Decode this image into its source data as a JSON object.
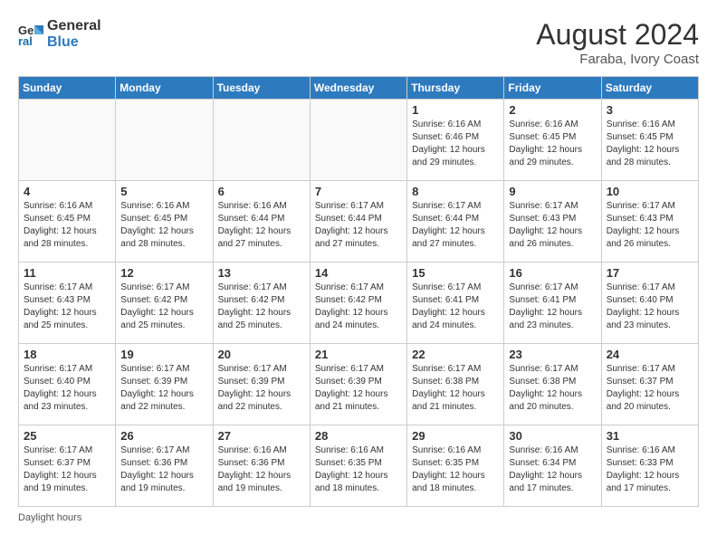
{
  "logo": {
    "line1": "General",
    "line2": "Blue"
  },
  "title": "August 2024",
  "location": "Faraba, Ivory Coast",
  "days_of_week": [
    "Sunday",
    "Monday",
    "Tuesday",
    "Wednesday",
    "Thursday",
    "Friday",
    "Saturday"
  ],
  "footer": "Daylight hours",
  "weeks": [
    [
      {
        "num": "",
        "info": ""
      },
      {
        "num": "",
        "info": ""
      },
      {
        "num": "",
        "info": ""
      },
      {
        "num": "",
        "info": ""
      },
      {
        "num": "1",
        "info": "Sunrise: 6:16 AM\nSunset: 6:46 PM\nDaylight: 12 hours\nand 29 minutes."
      },
      {
        "num": "2",
        "info": "Sunrise: 6:16 AM\nSunset: 6:45 PM\nDaylight: 12 hours\nand 29 minutes."
      },
      {
        "num": "3",
        "info": "Sunrise: 6:16 AM\nSunset: 6:45 PM\nDaylight: 12 hours\nand 28 minutes."
      }
    ],
    [
      {
        "num": "4",
        "info": "Sunrise: 6:16 AM\nSunset: 6:45 PM\nDaylight: 12 hours\nand 28 minutes."
      },
      {
        "num": "5",
        "info": "Sunrise: 6:16 AM\nSunset: 6:45 PM\nDaylight: 12 hours\nand 28 minutes."
      },
      {
        "num": "6",
        "info": "Sunrise: 6:16 AM\nSunset: 6:44 PM\nDaylight: 12 hours\nand 27 minutes."
      },
      {
        "num": "7",
        "info": "Sunrise: 6:17 AM\nSunset: 6:44 PM\nDaylight: 12 hours\nand 27 minutes."
      },
      {
        "num": "8",
        "info": "Sunrise: 6:17 AM\nSunset: 6:44 PM\nDaylight: 12 hours\nand 27 minutes."
      },
      {
        "num": "9",
        "info": "Sunrise: 6:17 AM\nSunset: 6:43 PM\nDaylight: 12 hours\nand 26 minutes."
      },
      {
        "num": "10",
        "info": "Sunrise: 6:17 AM\nSunset: 6:43 PM\nDaylight: 12 hours\nand 26 minutes."
      }
    ],
    [
      {
        "num": "11",
        "info": "Sunrise: 6:17 AM\nSunset: 6:43 PM\nDaylight: 12 hours\nand 25 minutes."
      },
      {
        "num": "12",
        "info": "Sunrise: 6:17 AM\nSunset: 6:42 PM\nDaylight: 12 hours\nand 25 minutes."
      },
      {
        "num": "13",
        "info": "Sunrise: 6:17 AM\nSunset: 6:42 PM\nDaylight: 12 hours\nand 25 minutes."
      },
      {
        "num": "14",
        "info": "Sunrise: 6:17 AM\nSunset: 6:42 PM\nDaylight: 12 hours\nand 24 minutes."
      },
      {
        "num": "15",
        "info": "Sunrise: 6:17 AM\nSunset: 6:41 PM\nDaylight: 12 hours\nand 24 minutes."
      },
      {
        "num": "16",
        "info": "Sunrise: 6:17 AM\nSunset: 6:41 PM\nDaylight: 12 hours\nand 23 minutes."
      },
      {
        "num": "17",
        "info": "Sunrise: 6:17 AM\nSunset: 6:40 PM\nDaylight: 12 hours\nand 23 minutes."
      }
    ],
    [
      {
        "num": "18",
        "info": "Sunrise: 6:17 AM\nSunset: 6:40 PM\nDaylight: 12 hours\nand 23 minutes."
      },
      {
        "num": "19",
        "info": "Sunrise: 6:17 AM\nSunset: 6:39 PM\nDaylight: 12 hours\nand 22 minutes."
      },
      {
        "num": "20",
        "info": "Sunrise: 6:17 AM\nSunset: 6:39 PM\nDaylight: 12 hours\nand 22 minutes."
      },
      {
        "num": "21",
        "info": "Sunrise: 6:17 AM\nSunset: 6:39 PM\nDaylight: 12 hours\nand 21 minutes."
      },
      {
        "num": "22",
        "info": "Sunrise: 6:17 AM\nSunset: 6:38 PM\nDaylight: 12 hours\nand 21 minutes."
      },
      {
        "num": "23",
        "info": "Sunrise: 6:17 AM\nSunset: 6:38 PM\nDaylight: 12 hours\nand 20 minutes."
      },
      {
        "num": "24",
        "info": "Sunrise: 6:17 AM\nSunset: 6:37 PM\nDaylight: 12 hours\nand 20 minutes."
      }
    ],
    [
      {
        "num": "25",
        "info": "Sunrise: 6:17 AM\nSunset: 6:37 PM\nDaylight: 12 hours\nand 19 minutes."
      },
      {
        "num": "26",
        "info": "Sunrise: 6:17 AM\nSunset: 6:36 PM\nDaylight: 12 hours\nand 19 minutes."
      },
      {
        "num": "27",
        "info": "Sunrise: 6:16 AM\nSunset: 6:36 PM\nDaylight: 12 hours\nand 19 minutes."
      },
      {
        "num": "28",
        "info": "Sunrise: 6:16 AM\nSunset: 6:35 PM\nDaylight: 12 hours\nand 18 minutes."
      },
      {
        "num": "29",
        "info": "Sunrise: 6:16 AM\nSunset: 6:35 PM\nDaylight: 12 hours\nand 18 minutes."
      },
      {
        "num": "30",
        "info": "Sunrise: 6:16 AM\nSunset: 6:34 PM\nDaylight: 12 hours\nand 17 minutes."
      },
      {
        "num": "31",
        "info": "Sunrise: 6:16 AM\nSunset: 6:33 PM\nDaylight: 12 hours\nand 17 minutes."
      }
    ]
  ]
}
